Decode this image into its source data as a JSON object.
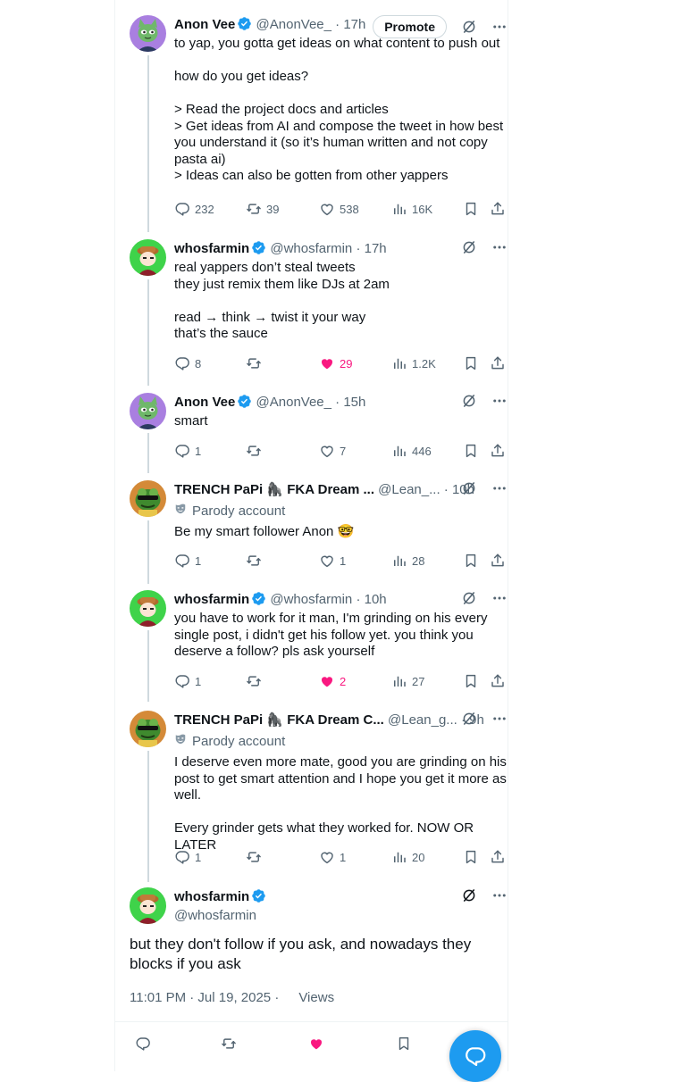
{
  "promote_label": "Promote",
  "replies": [
    {
      "name": "Anon Vee",
      "verified": true,
      "handle": "@AnonVee_",
      "time": "17h",
      "avatar": "green-cat",
      "show_promote": true,
      "body": "to yap, you gotta get ideas on what content to push out\n\nhow do you get ideas?\n\n> Read the project docs and articles\n> Get ideas from AI and compose the tweet in how best you understand it (so it’s human written and not copy pasta ai)\n> Ideas can also be gotten from other yappers",
      "reply_count": "232",
      "repost_count": "39",
      "like_count": "538",
      "liked": false,
      "views": "16K"
    },
    {
      "name": "whosfarmin",
      "verified": true,
      "handle": "@whosfarmin",
      "time": "17h",
      "avatar": "farmer",
      "body": "real yappers don’t steal tweets\nthey just remix them like DJs at 2am\n\nread → think → twist it your way\nthat’s the sauce",
      "reply_count": "8",
      "repost_count": "",
      "like_count": "29",
      "liked": true,
      "views": "1.2K"
    },
    {
      "name": "Anon Vee",
      "verified": true,
      "handle": "@AnonVee_",
      "time": "15h",
      "avatar": "green-cat",
      "body": "smart",
      "reply_count": "1",
      "repost_count": "",
      "like_count": "7",
      "liked": false,
      "views": "446"
    },
    {
      "name": "TRENCH PaPi 🦍 FKA Dream ...",
      "verified": false,
      "handle": "@Lean_...",
      "time": "10h",
      "avatar": "frog",
      "parody": "Parody account",
      "body": "Be my smart follower Anon 🤓",
      "reply_count": "1",
      "repost_count": "",
      "like_count": "1",
      "liked": false,
      "views": "28"
    },
    {
      "name": "whosfarmin",
      "verified": true,
      "handle": "@whosfarmin",
      "time": "10h",
      "avatar": "farmer",
      "body": "you have to work for it man, I'm grinding on his every single post, i didn't get his follow yet. you think you deserve a follow? pls ask yourself",
      "reply_count": "1",
      "repost_count": "",
      "like_count": "2",
      "liked": true,
      "views": "27"
    },
    {
      "name": "TRENCH PaPi 🦍 FKA Dream C...",
      "verified": false,
      "handle": "@Lean_g...",
      "time": "9h",
      "avatar": "frog",
      "parody": "Parody account",
      "body": "I deserve even more mate, good you are grinding on his post to get smart attention and I hope you get it more as well.\n\nEvery grinder gets what they worked for. NOW OR LATER",
      "reply_count": "1",
      "repost_count": "",
      "like_count": "1",
      "liked": false,
      "views": "20"
    }
  ],
  "main_tweet": {
    "name": "whosfarmin",
    "verified": true,
    "handle": "@whosfarmin",
    "avatar": "farmer",
    "body": "but they don't follow if you ask, and nowadays they blocks if you ask",
    "timestamp": "11:01 PM · Jul 19, 2025 ·",
    "views_label": "Views",
    "liked": true
  },
  "colors": {
    "accent": "#1d9bf0",
    "like": "#f91880",
    "muted": "#536471",
    "text": "#0f1419"
  },
  "icons": [
    "verified-badge-icon",
    "grok-icon",
    "more-icon",
    "reply-icon",
    "repost-icon",
    "like-icon",
    "views-icon",
    "bookmark-icon",
    "share-icon",
    "compose-reply-icon"
  ]
}
